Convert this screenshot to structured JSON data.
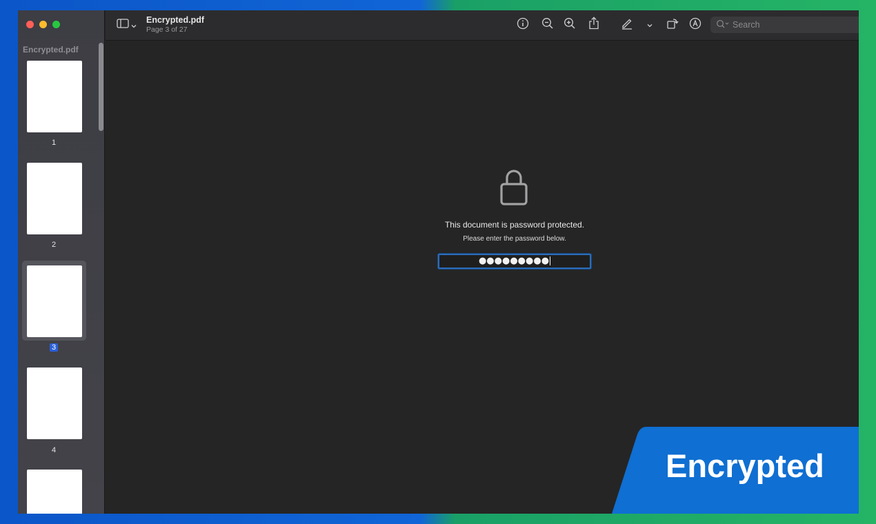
{
  "window": {
    "sidebar_title": "Encrypted.pdf",
    "thumbnails": [
      {
        "label": "1",
        "selected": false
      },
      {
        "label": "2",
        "selected": false
      },
      {
        "label": "3",
        "selected": true
      },
      {
        "label": "4",
        "selected": false
      },
      {
        "label": "",
        "selected": false
      }
    ]
  },
  "toolbar": {
    "title": "Encrypted.pdf",
    "subtitle": "Page 3 of 27",
    "search_placeholder": "Search",
    "icons": [
      "sidebar-toggle-icon",
      "info-icon",
      "zoom-out-icon",
      "zoom-in-icon",
      "share-icon",
      "markup-pen-icon",
      "chevron-down-icon",
      "rotate-icon",
      "annotate-icon",
      "search-icon"
    ]
  },
  "main": {
    "message": "This document is password protected.",
    "instruction": "Please enter the password below.",
    "password_value": "●●●●●●●●●"
  },
  "badge": {
    "label": "Encrypted",
    "color": "#0f6fd2"
  },
  "colors": {
    "accent": "#2c6cb8",
    "selection": "#2a5fd8"
  }
}
